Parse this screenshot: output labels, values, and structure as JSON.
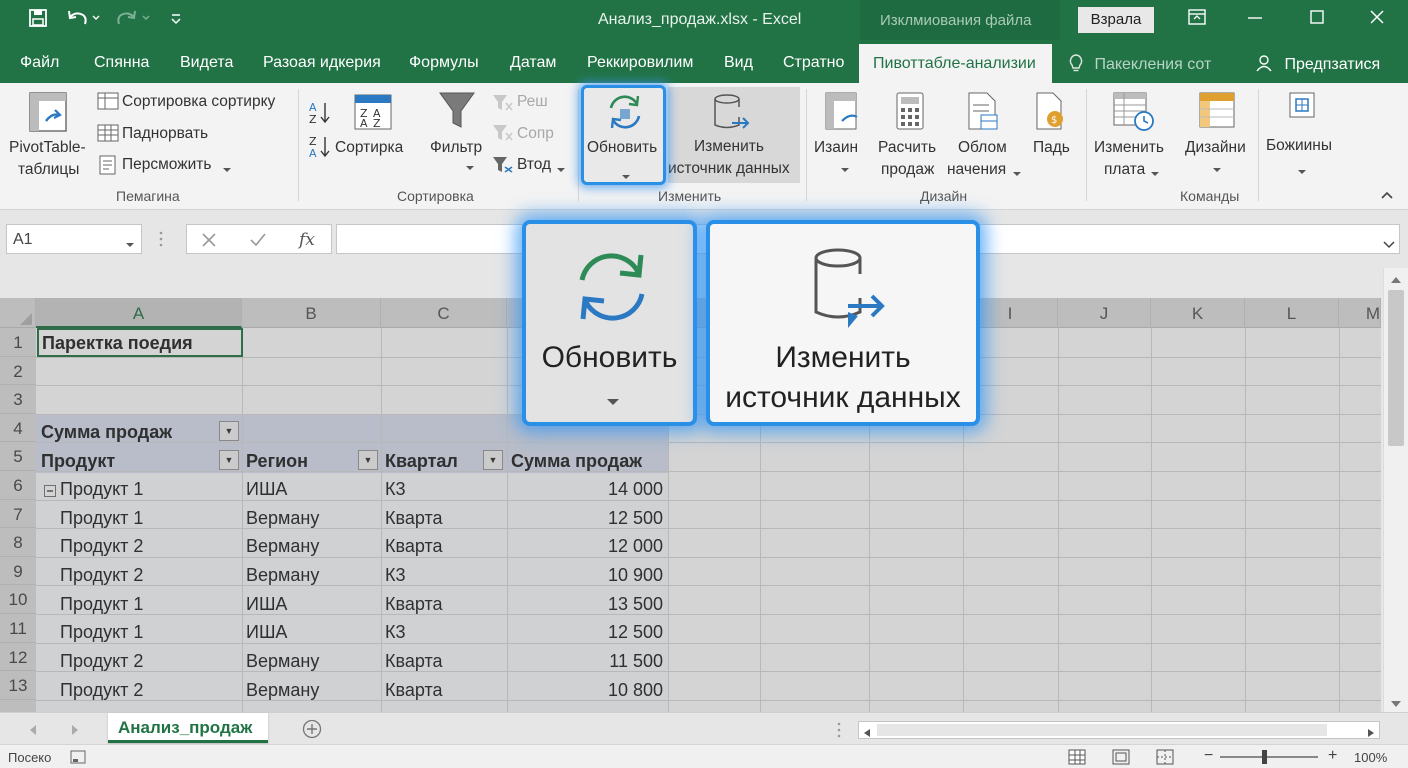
{
  "titlebar": {
    "title": "Анализ_продаж.xlsx  -  Excel",
    "search_text": "Изклмиования файла",
    "login_label": "Взрала"
  },
  "tabs": [
    "Файл",
    "Спянна",
    "Видета",
    "Разоая идкерия",
    "Формулы",
    "Датам",
    "Реккировилим",
    "Вид",
    "Стратно",
    "Пивоттабле-анализии",
    "Пакекления сот",
    "Предпзатися"
  ],
  "ribbon": {
    "pivottable_line1": "PivotTable-",
    "pivottable_line2": "таблицы",
    "sort_sort": "Сортировка сортирку",
    "padnorvat": "Паднорвать",
    "persmozhit": "Персможить",
    "group_pemagina": "Пемагина",
    "sort": "Сортирка",
    "filter": "Фильтр",
    "resh": "Реш",
    "sopr": "Сопр",
    "vtod": "Втод",
    "group_sortirovka": "Сортировка",
    "refresh": "Обновить",
    "change_line1": "Изменить",
    "change_line2": "источник данных",
    "group_izmenit": "Изменить",
    "izain": "Изаин",
    "raschit_line1": "Раcчить",
    "raschit_line2": "продаж",
    "oblom_line1": "Облом",
    "oblom_line2": "начения",
    "pad": "Падь",
    "group_dizain": "Дизайн",
    "izm_plata_line1": "Изменить",
    "izm_plata_line2": "плата",
    "dizaini": "Дизайни",
    "group_komandy": "Команды",
    "bozhiiny": "Божиины"
  },
  "formulabar": {
    "cell_ref": "A1"
  },
  "columns": [
    "A",
    "B",
    "C",
    "I",
    "J",
    "K",
    "L",
    "M"
  ],
  "rows": [
    "1",
    "2",
    "3",
    "4",
    "5",
    "6",
    "7",
    "8",
    "9",
    "10",
    "11",
    "12",
    "13"
  ],
  "sheet": {
    "title": "Паректка поедия",
    "summa_header": "Сумма продаж",
    "col_product": "Продукт",
    "col_region": "Регион",
    "col_quarter": "Квартал",
    "col_sum": "Сумма продаж",
    "data_rows": [
      {
        "product": "Продукт 1",
        "region": "ИША",
        "quarter": "К3",
        "sum": "14 000"
      },
      {
        "product": "Продукт 1",
        "region": "Верману",
        "quarter": "Кварта",
        "sum": "12 500"
      },
      {
        "product": "Продукт 2",
        "region": "Верману",
        "quarter": "Кварта",
        "sum": "12 000"
      },
      {
        "product": "Продукт 2",
        "region": "Верману",
        "quarter": "К3",
        "sum": "10 900"
      },
      {
        "product": "Продукт 1",
        "region": "ИША",
        "quarter": "Кварта",
        "sum": "13 500"
      },
      {
        "product": "Продукт 1",
        "region": "ИША",
        "quarter": "К3",
        "sum": "12 500"
      },
      {
        "product": "Продукт 2",
        "region": "Верману",
        "quarter": "Кварта",
        "sum": "11 500"
      },
      {
        "product": "Продукт 2",
        "region": "Верману",
        "quarter": "Кварта",
        "sum": "10 800"
      }
    ]
  },
  "magnified": {
    "refresh": "Обновить",
    "change_line1": "Изменить",
    "change_line2": "источник данных"
  },
  "sheet_tab": "Анализ_продаж",
  "status": {
    "ready": "Посеко",
    "zoom": "100%"
  },
  "colors": {
    "excel_green": "#217346",
    "highlight_blue": "#2a8fe6",
    "pivot_band": "#d9e1f0"
  }
}
